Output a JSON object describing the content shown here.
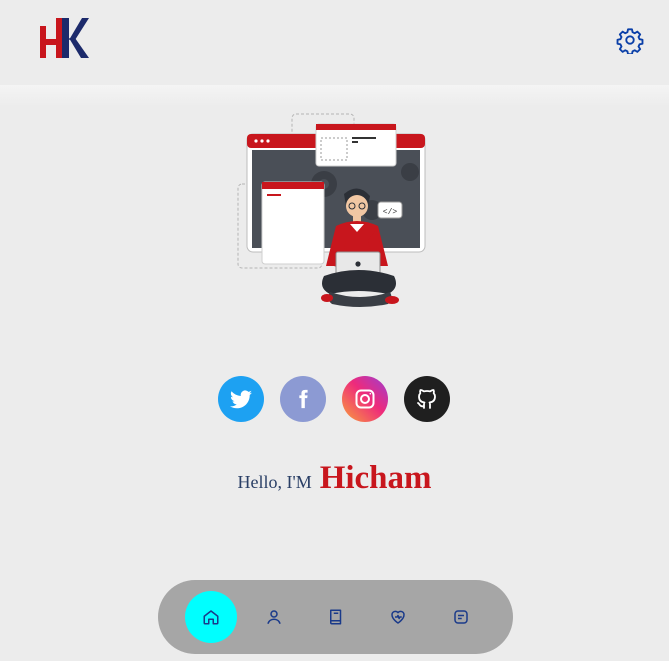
{
  "header": {
    "logo": {
      "text": "HK",
      "icon": "hk-logo",
      "colors": {
        "h": "#c8161d",
        "k": "#1c2a6b"
      }
    },
    "settings_icon": "gear-icon"
  },
  "hero": {
    "icon": "developer-laptop-illustration"
  },
  "socials": [
    {
      "name": "twitter",
      "icon": "twitter-icon",
      "color": "#1da1f2"
    },
    {
      "name": "facebook",
      "icon": "facebook-icon",
      "color": "#8c9ad3"
    },
    {
      "name": "instagram",
      "icon": "instagram-icon",
      "color": "#ee2a7b"
    },
    {
      "name": "github",
      "icon": "github-icon",
      "color": "#1f1f1f"
    }
  ],
  "greeting": {
    "hello": "Hello, I'M",
    "name": "Hicham"
  },
  "nav": {
    "items": [
      {
        "id": "home",
        "icon": "home-icon",
        "active": true
      },
      {
        "id": "about",
        "icon": "user-icon",
        "active": false
      },
      {
        "id": "portfolio",
        "icon": "book-icon",
        "active": false
      },
      {
        "id": "services",
        "icon": "heart-icon",
        "active": false
      },
      {
        "id": "contact",
        "icon": "message-icon",
        "active": false
      }
    ],
    "active_color": "#00ffff"
  }
}
